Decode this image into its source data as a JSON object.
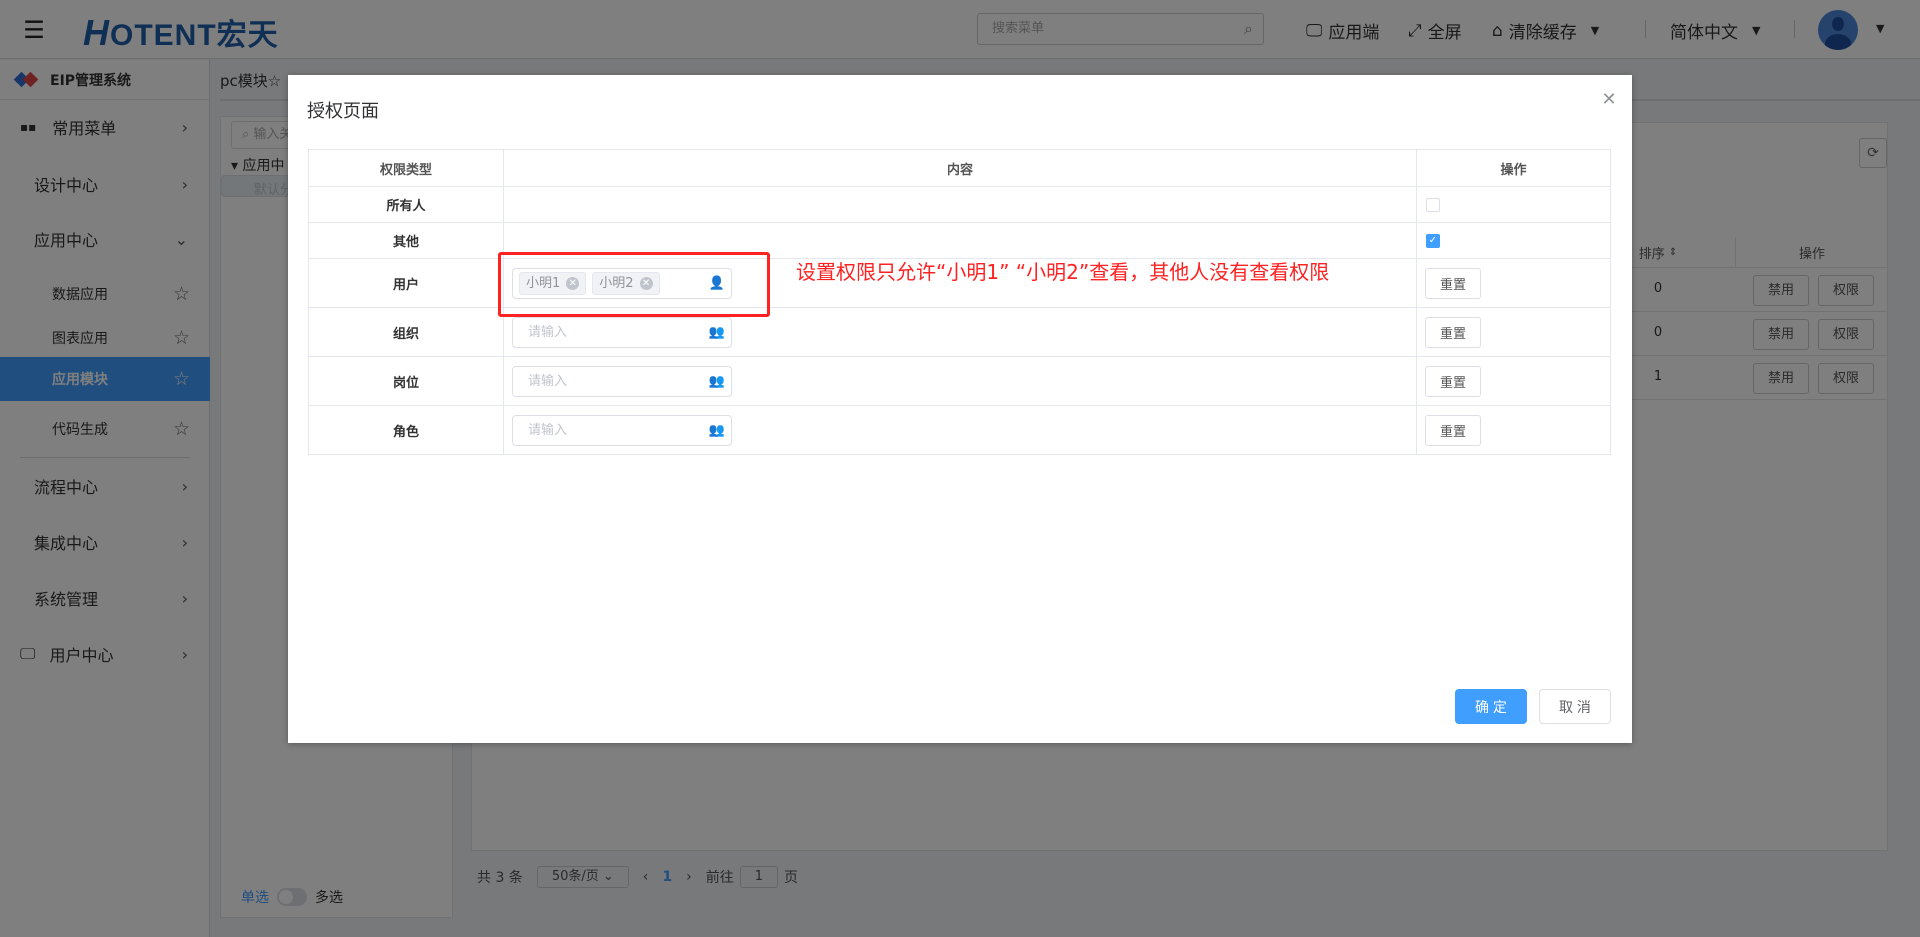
{
  "header": {
    "logo_text": "HOTENT宏天",
    "search_placeholder": "搜索菜单",
    "app_client": "应用端",
    "fullscreen": "全屏",
    "clear_cache": "清除缓存",
    "language": "简体中文"
  },
  "sidebar": {
    "brand": "EIP管理系统",
    "items": [
      {
        "label": "常用菜单"
      },
      {
        "label": "设计中心"
      },
      {
        "label": "应用中心"
      },
      {
        "label": "数据应用"
      },
      {
        "label": "图表应用"
      },
      {
        "label": "应用模块",
        "active": true
      },
      {
        "label": "代码生成"
      },
      {
        "label": "流程中心"
      },
      {
        "label": "集成中心"
      },
      {
        "label": "系统管理"
      },
      {
        "label": "用户中心"
      }
    ]
  },
  "tabs": {
    "current": "pc模块☆"
  },
  "tree": {
    "search_placeholder": "输入关",
    "root": "应用中",
    "child": "默认分",
    "single": "单选",
    "multi": "多选"
  },
  "background_table": {
    "sort_header": "排序",
    "op_header": "操作",
    "rows": [
      {
        "sort": "0",
        "disable": "禁用",
        "perm": "权限"
      },
      {
        "sort": "0",
        "disable": "禁用",
        "perm": "权限"
      },
      {
        "sort": "1",
        "disable": "禁用",
        "perm": "权限"
      }
    ]
  },
  "pagination": {
    "total": "共 3 条",
    "page_size": "50条/页",
    "current": "1",
    "goto_prefix": "前往",
    "goto_value": "1",
    "goto_suffix": "页"
  },
  "dialog": {
    "title": "授权页面",
    "columns": [
      "权限类型",
      "内容",
      "操作"
    ],
    "rows": {
      "everyone": {
        "label": "所有人",
        "checked": false
      },
      "others": {
        "label": "其他",
        "checked": true
      },
      "user": {
        "label": "用户",
        "tags": [
          "小明1",
          "小明2"
        ],
        "reset": "重置"
      },
      "org": {
        "label": "组织",
        "placeholder": "请输入",
        "reset": "重置"
      },
      "post": {
        "label": "岗位",
        "placeholder": "请输入",
        "reset": "重置"
      },
      "role": {
        "label": "角色",
        "placeholder": "请输入",
        "reset": "重置"
      }
    },
    "annotation": "设置权限只允许“小明1” “小明2”查看，其他人没有查看权限",
    "confirm": "确 定",
    "cancel": "取 消"
  },
  "colors": {
    "primary": "#409eff",
    "annotation": "#ff2222"
  }
}
